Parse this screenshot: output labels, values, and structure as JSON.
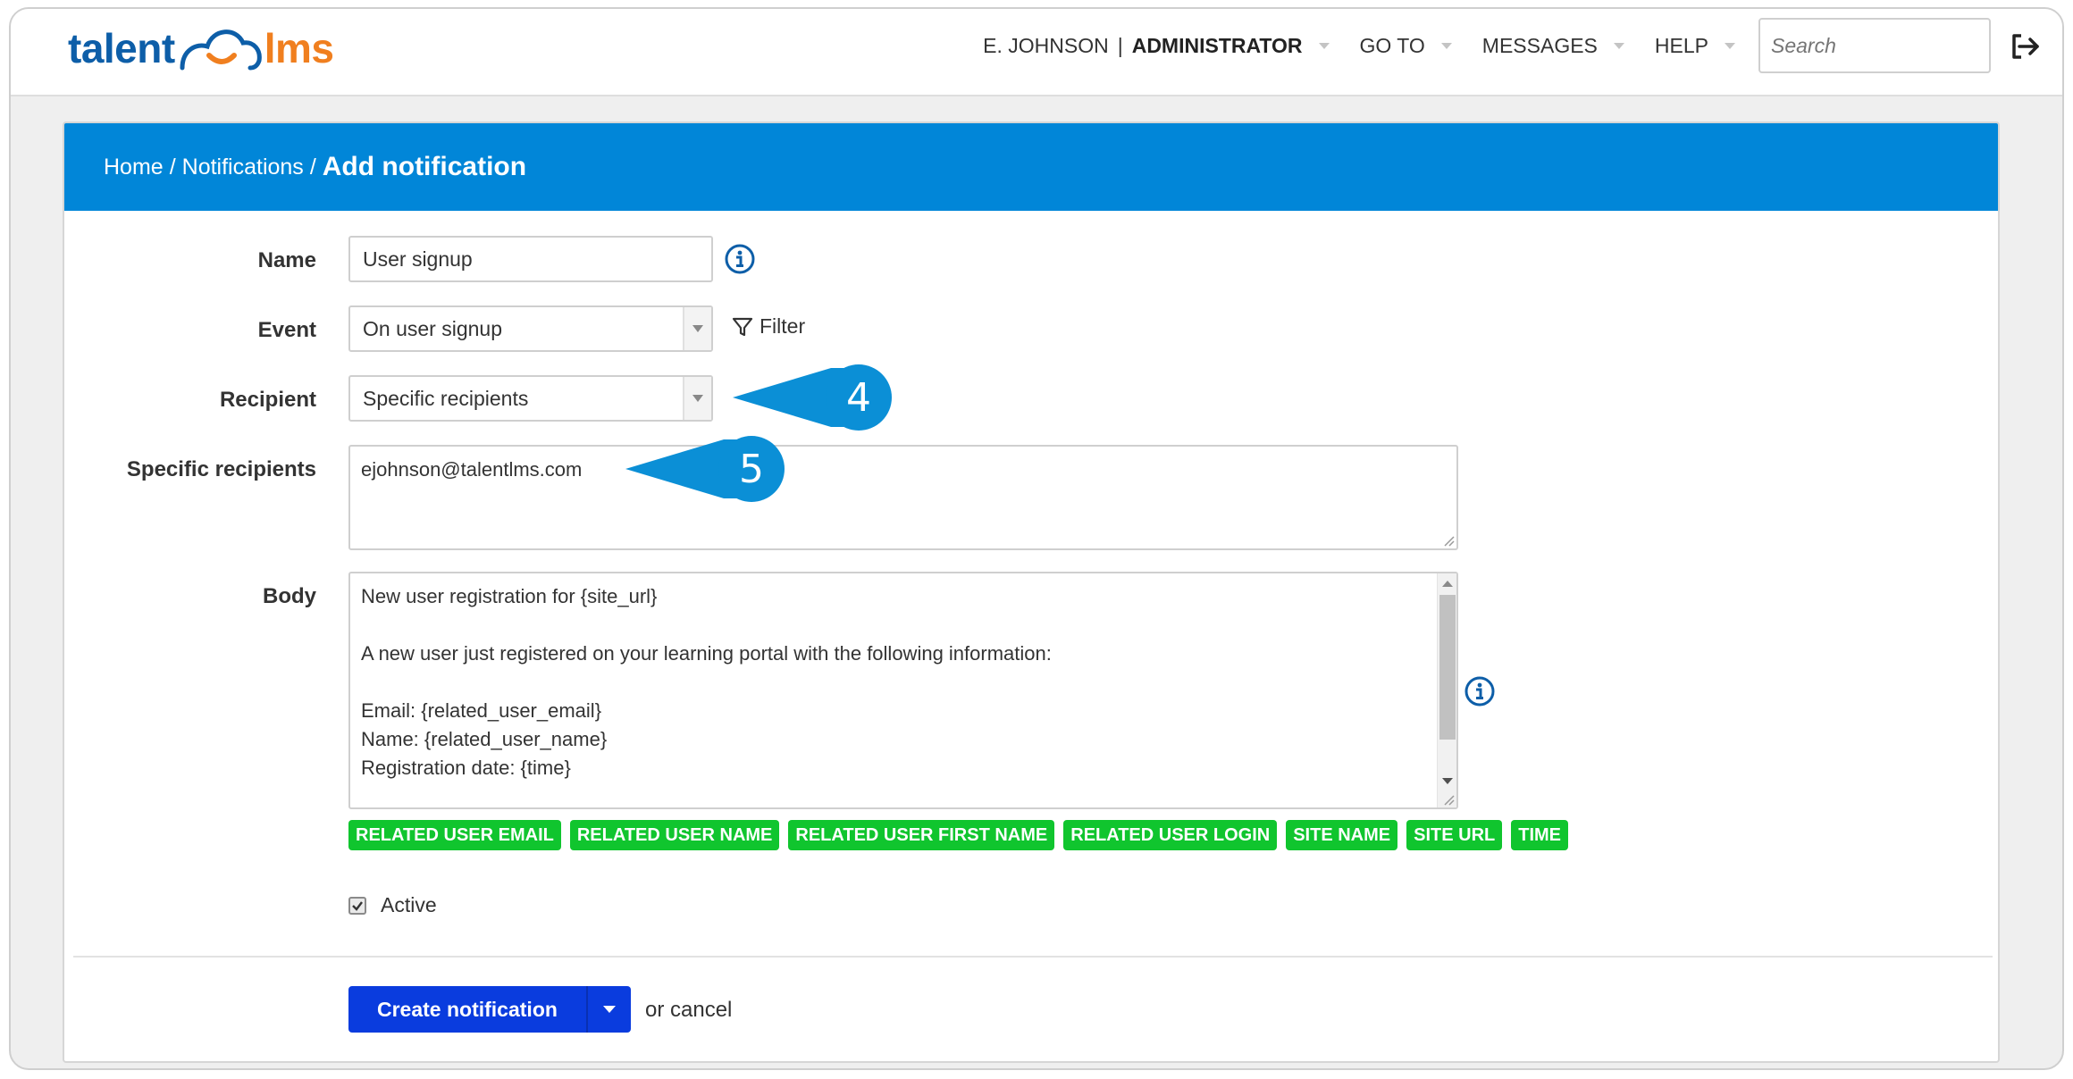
{
  "header": {
    "logo": {
      "part1": "talent",
      "part2": "lms",
      "colors": {
        "talent": "#0d5ea8",
        "lms": "#f07f1f"
      }
    },
    "user_name": "E. JOHNSON",
    "separator": "|",
    "user_role": "ADMINISTRATOR",
    "nav": [
      {
        "label": "GO TO"
      },
      {
        "label": "MESSAGES"
      },
      {
        "label": "HELP"
      }
    ],
    "search_placeholder": "Search",
    "logout_icon": "logout-icon"
  },
  "breadcrumb": {
    "home": "Home",
    "sep": "/",
    "notifications": "Notifications",
    "current": "Add notification"
  },
  "form": {
    "name": {
      "label": "Name",
      "value": "User signup"
    },
    "event": {
      "label": "Event",
      "value": "On user signup",
      "filter_label": "Filter"
    },
    "recipient": {
      "label": "Recipient",
      "value": "Specific recipients"
    },
    "specific_recipients": {
      "label": "Specific recipients",
      "value": "ejohnson@talentlms.com"
    },
    "body": {
      "label": "Body",
      "value": "New user registration for {site_url}\n\nA new user just registered on your learning portal with the following information:\n\nEmail: {related_user_email}\nName: {related_user_name}\nRegistration date: {time}"
    },
    "tags": [
      "Related user email",
      "Related user name",
      "Related user first name",
      "Related user login",
      "Site name",
      "Site url",
      "Time"
    ],
    "active": {
      "label": "Active",
      "checked": true
    }
  },
  "callouts": [
    "4",
    "5"
  ],
  "actions": {
    "create_label": "Create notification",
    "or_cancel": "or cancel"
  },
  "colors": {
    "header_blue": "#0186d8",
    "tag_green": "#10c52e",
    "button_blue": "#0a3cde",
    "callout_blue": "#0b8fd6",
    "info_icon": "#0d5ea8"
  }
}
